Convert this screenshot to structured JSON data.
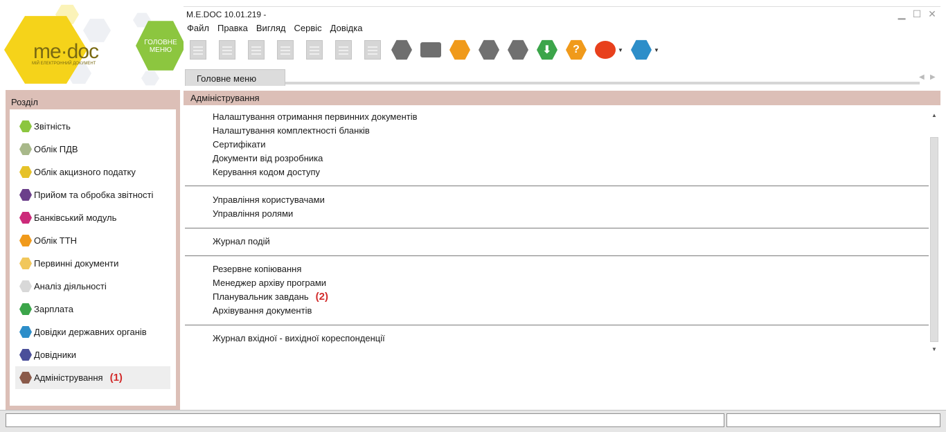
{
  "logo": {
    "brand": "me·doc",
    "tagline": "МІЙ ЕЛЕКТРОННИЙ ДОКУМЕНТ",
    "main_menu_hex_label": "ГОЛОВНЕ МЕНЮ"
  },
  "window": {
    "title": "M.E.DOC 10.01.219  -",
    "minimize": "▁",
    "maximize": "☐",
    "close": "✕"
  },
  "menu": [
    "Файл",
    "Правка",
    "Вигляд",
    "Сервіс",
    "Довідка"
  ],
  "toolbar": {
    "icons": [
      "new-document-icon",
      "delete-document-icon",
      "copy-document-icon",
      "edit-document-icon",
      "add-row-icon",
      "search-document-icon",
      "delete-row-icon",
      "preview-icon",
      "print-icon",
      "send-envelope-icon",
      "magnifier-icon",
      "filter-icon",
      "download-update-icon",
      "help-icon",
      "chat-icon",
      "video-help-icon"
    ],
    "help_glyph": "?",
    "download_glyph": "⬇"
  },
  "tabs": {
    "main": "Головне меню"
  },
  "left_panel": {
    "header": "Розділ",
    "items": [
      {
        "label": "Звітність",
        "color": "#8cc63f"
      },
      {
        "label": "Облік ПДВ",
        "color": "#a8b88a"
      },
      {
        "label": "Облік акцизного податку",
        "color": "#e6c229"
      },
      {
        "label": "Прийом та обробка звітності",
        "color": "#6b3f8a"
      },
      {
        "label": "Банківський модуль",
        "color": "#cc2a7a"
      },
      {
        "label": "Облік ТТН",
        "color": "#f09a1b"
      },
      {
        "label": "Первинні документи",
        "color": "#f1c75b"
      },
      {
        "label": "Аналіз діяльності",
        "color": "#e0e0e0"
      },
      {
        "label": "Зарплата",
        "color": "#3ca54a"
      },
      {
        "label": "Довідки державних органів",
        "color": "#2d8ec9"
      },
      {
        "label": "Довідники",
        "color": "#4a4f9a"
      },
      {
        "label": "Адміністрування",
        "color": "#8a5a4a"
      }
    ],
    "note_admin": "(1)"
  },
  "content": {
    "header": "Адміністрування",
    "groups": [
      [
        "Налаштування отримання первинних документів",
        "Налаштування комплектності бланків",
        "Сертифікати",
        "Документи від розробника",
        "Керування кодом доступу"
      ],
      [
        "Управління користувачами",
        "Управління ролями"
      ],
      [
        "Журнал подій"
      ],
      [
        "Резервне копіювання",
        "Менеджер архіву програми",
        "Планувальник завдань",
        "Архівування документів"
      ],
      [
        "Журнал вхідної - вихідної кореспонденції"
      ]
    ],
    "note_scheduler": "(2)"
  },
  "colors": {
    "section_header_bg": "#dcbfb7",
    "note_red": "#d22b2b"
  }
}
